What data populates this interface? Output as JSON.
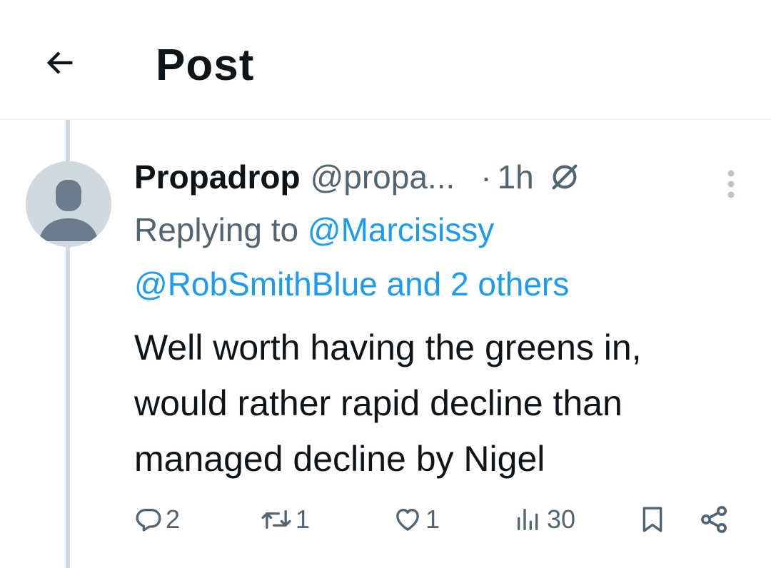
{
  "header": {
    "title": "Post"
  },
  "post": {
    "display_name": "Propadrop",
    "handle": "@propa...",
    "dot": "·",
    "time": "1h",
    "replying_prefix": "Replying to",
    "replying_first": "@Marcisissy",
    "replying_rest": "@RobSmithBlue and 2 others",
    "body_lines": [
      "Well worth having the greens in,",
      "would rather rapid decline than",
      "managed decline by Nigel"
    ]
  },
  "actions": {
    "replies": "2",
    "reposts": "1",
    "likes": "1",
    "views": "30"
  },
  "icons": {
    "back": "arrow-left-icon",
    "no_circle": "no-circle-icon",
    "more": "more-vertical-icon",
    "reply": "reply-icon",
    "repost": "repost-icon",
    "like": "heart-icon",
    "views": "analytics-icon",
    "bookmark": "bookmark-icon",
    "share": "share-icon"
  },
  "colors": {
    "text": "#0f1419",
    "secondary": "#536471",
    "link": "#1d9bf0",
    "thread_line": "#cfd9de"
  }
}
